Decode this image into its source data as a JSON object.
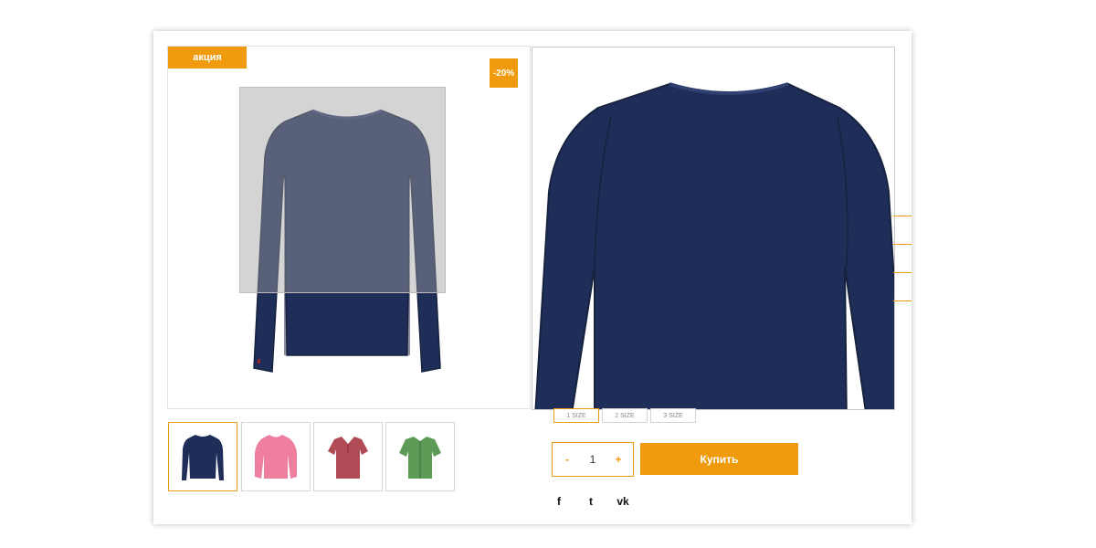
{
  "product": {
    "badge_sale": "акция",
    "badge_discount": "-20%"
  },
  "gallery": {
    "thumbnails": [
      {
        "name": "navy long-sleeve shirt",
        "color": "#1f2d59"
      },
      {
        "name": "pink blouse",
        "color": "#ee7f9f"
      },
      {
        "name": "red polo shirt",
        "color": "#b04a55"
      },
      {
        "name": "green short-sleeve shirt",
        "color": "#5d9a55"
      }
    ]
  },
  "sizes": [
    "1 SIZE",
    "2 SIZE",
    "3 SIZE"
  ],
  "quantity": {
    "minus": "-",
    "value": "1",
    "plus": "+"
  },
  "buy_label": "Купить",
  "social": {
    "facebook": "f",
    "twitter": "t",
    "vk": "vk"
  },
  "colors": {
    "accent": "#f09a0d",
    "shirt": "#1f2d59"
  }
}
